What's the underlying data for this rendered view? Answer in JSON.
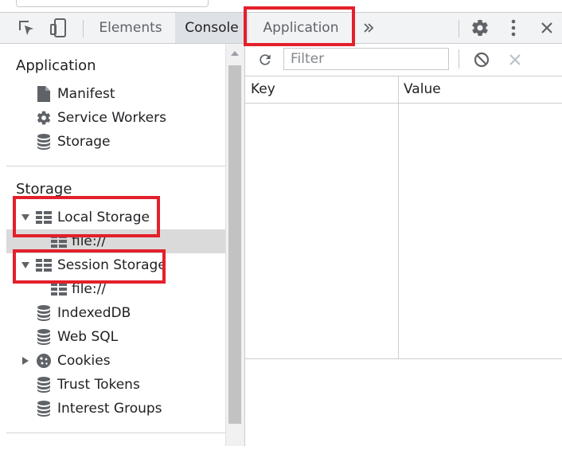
{
  "tabs": {
    "elements": "Elements",
    "console": "Console",
    "application": "Application"
  },
  "icons": {
    "inspect": "inspect-element-icon",
    "device": "device-toolbar-icon",
    "more_tabs": "chevron-double-right-icon",
    "settings": "gear-icon",
    "menu": "kebab-menu-icon",
    "close": "close-icon"
  },
  "sidebar": {
    "application_section": {
      "title": "Application",
      "items": [
        "Manifest",
        "Service Workers",
        "Storage"
      ]
    },
    "storage_section": {
      "title": "Storage",
      "local_storage": "Local Storage",
      "local_storage_child": "file://",
      "session_storage": "Session Storage",
      "session_storage_child": "file://",
      "items": [
        "IndexedDB",
        "Web SQL",
        "Cookies",
        "Trust Tokens",
        "Interest Groups"
      ]
    }
  },
  "toolbar": {
    "filter_placeholder": "Filter"
  },
  "table": {
    "columns": [
      "Key",
      "Value"
    ]
  },
  "colors": {
    "highlight": "#e3202b",
    "selected_row": "#dadada"
  }
}
